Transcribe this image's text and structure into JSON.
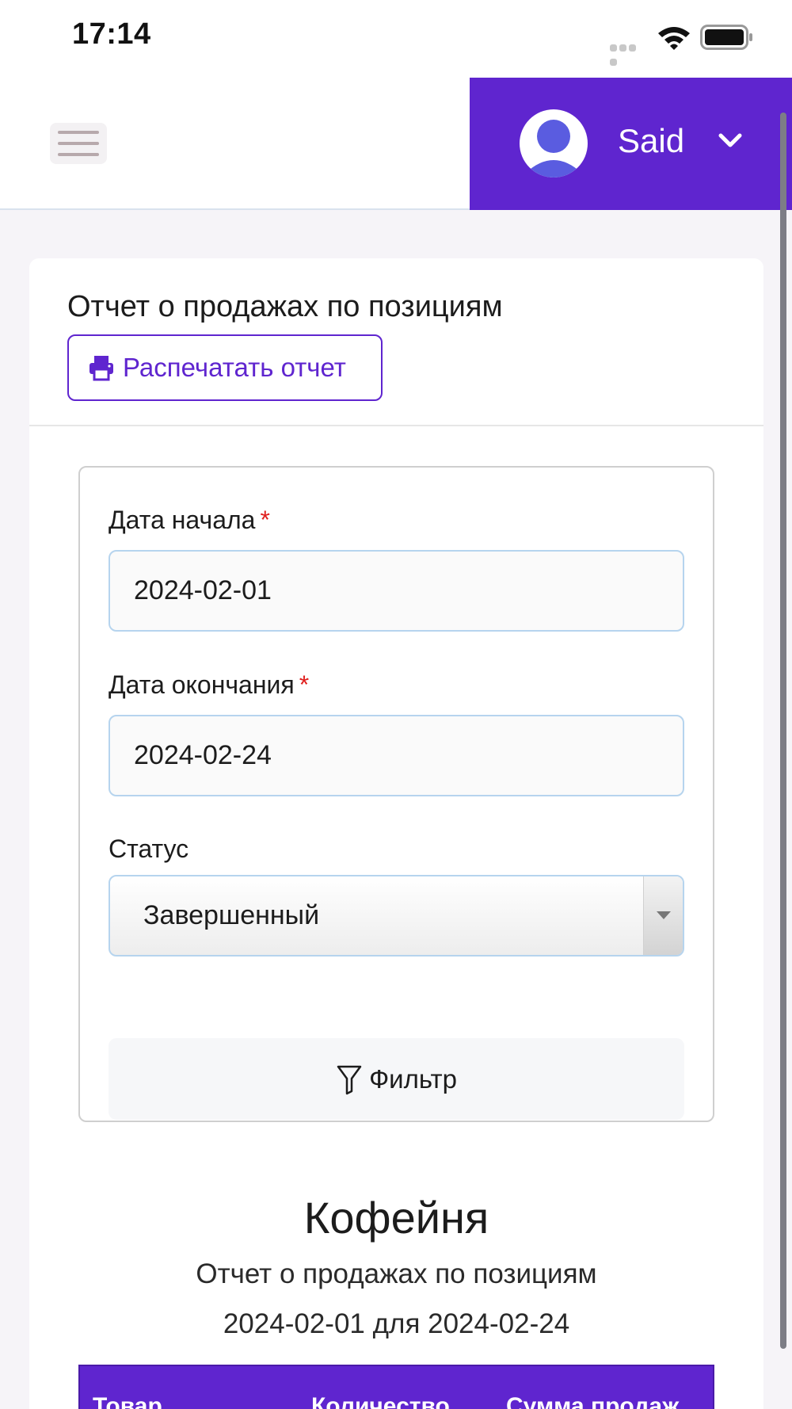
{
  "status_bar": {
    "time": "17:14"
  },
  "header": {
    "user_name": "Said",
    "accent_color": "#5f25cf"
  },
  "report_card": {
    "title": "Отчет о продажах по позициям",
    "print_label": "Распечатать отчет"
  },
  "filter": {
    "start_label": "Дата начала",
    "start_value": "2024-02-01",
    "end_label": "Дата окончания",
    "end_value": "2024-02-24",
    "required_mark": "*",
    "status_label": "Статус",
    "status_value": "Завершенный",
    "filter_button": "Фильтр"
  },
  "report": {
    "shop_name": "Кофейня",
    "subtitle": "Отчет о продажах по позициям",
    "range": "2024-02-01 для 2024-02-24"
  },
  "table": {
    "columns": [
      "Товар",
      "Количество",
      "Сумма продаж"
    ]
  }
}
